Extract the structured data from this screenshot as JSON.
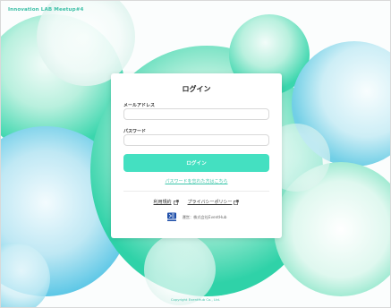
{
  "app": {
    "title": "Innovation LAB Meetup#4"
  },
  "login": {
    "title": "ログイン",
    "email_label": "メールアドレス",
    "email_value": "",
    "password_label": "パスワード",
    "password_value": "",
    "submit_label": "ログイン",
    "forgot_link": "パスワードを忘れた方はこちら"
  },
  "links": {
    "terms": "利用規約",
    "privacy": "プライバシーポリシー"
  },
  "provider": {
    "text": "運営：株式会社EventHub"
  },
  "footer": {
    "copyright": "Copyright EventHub Co., Ltd."
  },
  "colors": {
    "accent": "#44e0c1",
    "brand_text": "#3bbfa6"
  },
  "icons": {
    "external": "external-link-icon",
    "logo": "eventhub-logo"
  }
}
